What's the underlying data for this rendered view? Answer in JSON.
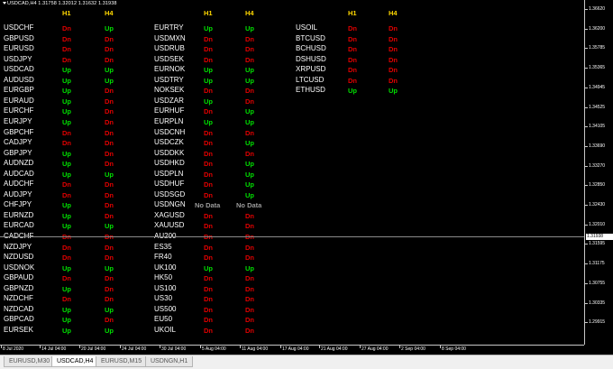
{
  "chart": {
    "title": "USDCAD,H4  1.31758 1.32012 1.31632 1.31938",
    "current_price": "1.31938"
  },
  "headers": {
    "h1": "H1",
    "h4": "H4"
  },
  "columns": [
    {
      "rows": [
        {
          "symbol": "USDCHF",
          "h1": "Dn",
          "h4": "Up"
        },
        {
          "symbol": "GBPUSD",
          "h1": "Dn",
          "h4": "Dn"
        },
        {
          "symbol": "EURUSD",
          "h1": "Dn",
          "h4": "Dn"
        },
        {
          "symbol": "USDJPY",
          "h1": "Dn",
          "h4": "Dn"
        },
        {
          "symbol": "USDCAD",
          "h1": "Up",
          "h4": "Up"
        },
        {
          "symbol": "AUDUSD",
          "h1": "Up",
          "h4": "Up"
        },
        {
          "symbol": "EURGBP",
          "h1": "Up",
          "h4": "Dn"
        },
        {
          "symbol": "EURAUD",
          "h1": "Up",
          "h4": "Dn"
        },
        {
          "symbol": "EURCHF",
          "h1": "Up",
          "h4": "Dn"
        },
        {
          "symbol": "EURJPY",
          "h1": "Up",
          "h4": "Dn"
        },
        {
          "symbol": "GBPCHF",
          "h1": "Dn",
          "h4": "Dn"
        },
        {
          "symbol": "CADJPY",
          "h1": "Dn",
          "h4": "Dn"
        },
        {
          "symbol": "GBPJPY",
          "h1": "Up",
          "h4": "Dn"
        },
        {
          "symbol": "AUDNZD",
          "h1": "Up",
          "h4": "Dn"
        },
        {
          "symbol": "AUDCAD",
          "h1": "Up",
          "h4": "Up"
        },
        {
          "symbol": "AUDCHF",
          "h1": "Dn",
          "h4": "Dn"
        },
        {
          "symbol": "AUDJPY",
          "h1": "Dn",
          "h4": "Dn"
        },
        {
          "symbol": "CHFJPY",
          "h1": "Up",
          "h4": "Dn"
        },
        {
          "symbol": "EURNZD",
          "h1": "Up",
          "h4": "Dn"
        },
        {
          "symbol": "EURCAD",
          "h1": "Up",
          "h4": "Up"
        },
        {
          "symbol": "CADCHF",
          "h1": "Dn",
          "h4": "Dn"
        },
        {
          "symbol": "NZDJPY",
          "h1": "Dn",
          "h4": "Dn"
        },
        {
          "symbol": "NZDUSD",
          "h1": "Dn",
          "h4": "Dn"
        },
        {
          "symbol": "USDNOK",
          "h1": "Up",
          "h4": "Up"
        },
        {
          "symbol": "GBPAUD",
          "h1": "Dn",
          "h4": "Dn"
        },
        {
          "symbol": "GBPNZD",
          "h1": "Up",
          "h4": "Dn"
        },
        {
          "symbol": "NZDCHF",
          "h1": "Dn",
          "h4": "Dn"
        },
        {
          "symbol": "NZDCAD",
          "h1": "Up",
          "h4": "Up"
        },
        {
          "symbol": "GBPCAD",
          "h1": "Up",
          "h4": "Dn"
        },
        {
          "symbol": "EURSEK",
          "h1": "Up",
          "h4": "Up"
        }
      ]
    },
    {
      "rows": [
        {
          "symbol": "EURTRY",
          "h1": "Up",
          "h4": "Up"
        },
        {
          "symbol": "USDMXN",
          "h1": "Dn",
          "h4": "Dn"
        },
        {
          "symbol": "USDRUB",
          "h1": "Dn",
          "h4": "Dn"
        },
        {
          "symbol": "USDSEK",
          "h1": "Dn",
          "h4": "Dn"
        },
        {
          "symbol": "EURNOK",
          "h1": "Up",
          "h4": "Up"
        },
        {
          "symbol": "USDTRY",
          "h1": "Up",
          "h4": "Up"
        },
        {
          "symbol": "NOKSEK",
          "h1": "Dn",
          "h4": "Dn"
        },
        {
          "symbol": "USDZAR",
          "h1": "Up",
          "h4": "Dn"
        },
        {
          "symbol": "EURHUF",
          "h1": "Dn",
          "h4": "Up"
        },
        {
          "symbol": "EURPLN",
          "h1": "Up",
          "h4": "Up"
        },
        {
          "symbol": "USDCNH",
          "h1": "Dn",
          "h4": "Dn"
        },
        {
          "symbol": "USDCZK",
          "h1": "Dn",
          "h4": "Up"
        },
        {
          "symbol": "USDDKK",
          "h1": "Dn",
          "h4": "Dn"
        },
        {
          "symbol": "USDHKD",
          "h1": "Dn",
          "h4": "Up"
        },
        {
          "symbol": "USDPLN",
          "h1": "Dn",
          "h4": "Up"
        },
        {
          "symbol": "USDHUF",
          "h1": "Dn",
          "h4": "Up"
        },
        {
          "symbol": "USDSGD",
          "h1": "Dn",
          "h4": "Up"
        },
        {
          "symbol": "USDNGN",
          "h1": "No Data",
          "h4": "No Data"
        },
        {
          "symbol": "XAGUSD",
          "h1": "Dn",
          "h4": "Dn"
        },
        {
          "symbol": "XAUUSD",
          "h1": "Dn",
          "h4": "Dn"
        },
        {
          "symbol": "AU200",
          "h1": "Dn",
          "h4": "Dn"
        },
        {
          "symbol": "ES35",
          "h1": "Dn",
          "h4": "Dn"
        },
        {
          "symbol": "FR40",
          "h1": "Dn",
          "h4": "Dn"
        },
        {
          "symbol": "UK100",
          "h1": "Up",
          "h4": "Up"
        },
        {
          "symbol": "HK50",
          "h1": "Dn",
          "h4": "Dn"
        },
        {
          "symbol": "US100",
          "h1": "Dn",
          "h4": "Dn"
        },
        {
          "symbol": "US30",
          "h1": "Dn",
          "h4": "Dn"
        },
        {
          "symbol": "US500",
          "h1": "Dn",
          "h4": "Dn"
        },
        {
          "symbol": "EU50",
          "h1": "Dn",
          "h4": "Dn"
        },
        {
          "symbol": "UKOIL",
          "h1": "Dn",
          "h4": "Dn"
        }
      ]
    },
    {
      "rows": [
        {
          "symbol": "USOIL",
          "h1": "Dn",
          "h4": "Dn"
        },
        {
          "symbol": "BTCUSD",
          "h1": "Dn",
          "h4": "Dn"
        },
        {
          "symbol": "BCHUSD",
          "h1": "Dn",
          "h4": "Dn"
        },
        {
          "symbol": "DSHUSD",
          "h1": "Dn",
          "h4": "Dn"
        },
        {
          "symbol": "XRPUSD",
          "h1": "Dn",
          "h4": "Dn"
        },
        {
          "symbol": "LTCUSD",
          "h1": "Dn",
          "h4": "Dn"
        },
        {
          "symbol": "ETHUSD",
          "h1": "Up",
          "h4": "Up"
        }
      ]
    }
  ],
  "price_axis": [
    "1.36620",
    "1.36200",
    "1.35785",
    "1.35365",
    "1.34945",
    "1.34525",
    "1.34105",
    "1.33690",
    "1.33270",
    "1.32850",
    "1.32430",
    "1.32010",
    "1.31595",
    "1.31175",
    "1.30755",
    "1.30335",
    "1.29915"
  ],
  "time_axis": [
    "8 Jul 2020",
    "14 Jul 04:00",
    "20 Jul 04:00",
    "24 Jul 04:00",
    "30 Jul 04:00",
    "5 Aug 04:00",
    "11 Aug 04:00",
    "17 Aug 04:00",
    "21 Aug 04:00",
    "27 Aug 04:00",
    "2 Sep 04:00",
    "8 Sep 04:00"
  ],
  "tabs": [
    {
      "label": "EURUSD,M30",
      "active": false
    },
    {
      "label": "USDCAD,H4",
      "active": true
    },
    {
      "label": "EURUSD,M15",
      "active": false
    },
    {
      "label": "USDNGN,H1",
      "active": false
    }
  ],
  "colors": {
    "up": "#00e000",
    "down": "#e00000",
    "header": "#ffd800",
    "no_data": "#9a9a9a"
  }
}
